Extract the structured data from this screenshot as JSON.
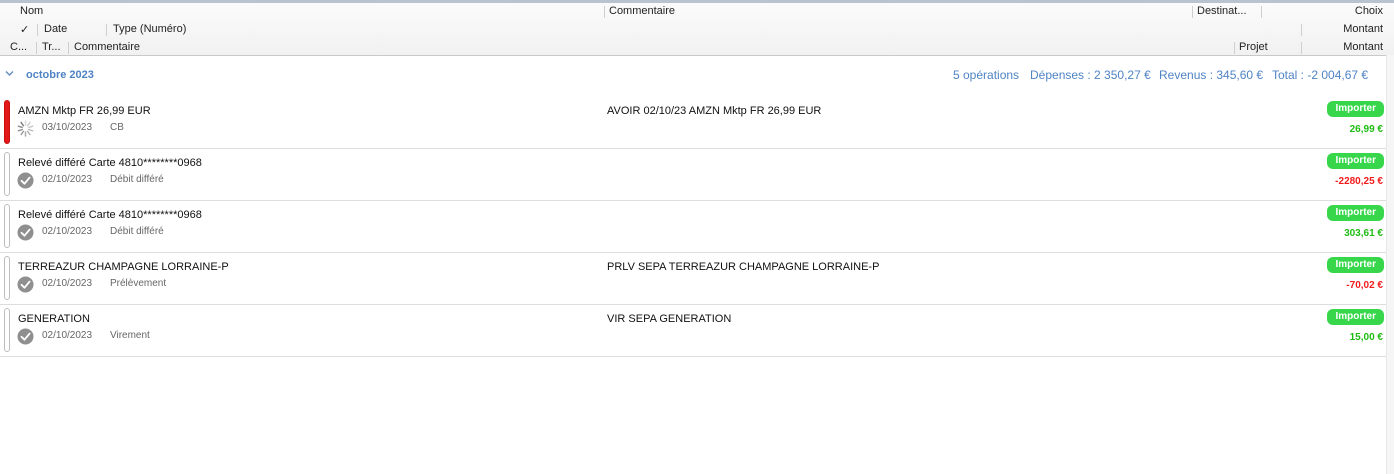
{
  "header": {
    "row1": {
      "name": "Nom",
      "comment": "Commentaire",
      "destination": "Destinat...",
      "choice": "Choix"
    },
    "row2": {
      "check": "✓",
      "date": "Date",
      "type": "Type (Numéro)",
      "amount": "Montant"
    },
    "row3": {
      "c": "C...",
      "tr": "Tr...",
      "comment": "Commentaire",
      "project": "Projet",
      "amount": "Montant"
    }
  },
  "group": {
    "title": "octobre 2023",
    "operations": "5 opérations",
    "expenses": "Dépenses : 2 350,27 €",
    "income": "Revenus : 345,60 €",
    "total": "Total : -2 004,67 €"
  },
  "colors": {
    "accent": "#4f83c4",
    "import": "#37d64b",
    "positive": "#1fbd14",
    "negative": "#f21b1b",
    "flag": "#e31818"
  },
  "rows": [
    {
      "name": "AMZN Mktp FR 26,99 EUR",
      "comment": "AVOIR 02/10/23 AMZN Mktp FR 26,99 EUR",
      "date": "03/10/2023",
      "type": "CB",
      "status": "spinner-icon",
      "marker": "red",
      "import_label": "Importer",
      "amount": "26,99 €",
      "sign": "pos"
    },
    {
      "name": "Relevé différé Carte 4810********0968",
      "comment": "",
      "date": "02/10/2023",
      "type": "Débit différé",
      "status": "check-circle-icon",
      "marker": "empty",
      "import_label": "Importer",
      "amount": "-2280,25 €",
      "sign": "neg"
    },
    {
      "name": "Relevé différé Carte 4810********0968",
      "comment": "",
      "date": "02/10/2023",
      "type": "Débit différé",
      "status": "check-circle-icon",
      "marker": "empty",
      "import_label": "Importer",
      "amount": "303,61 €",
      "sign": "pos"
    },
    {
      "name": "TERREAZUR CHAMPAGNE LORRAINE-P",
      "comment": "PRLV SEPA TERREAZUR CHAMPAGNE LORRAINE-P",
      "date": "02/10/2023",
      "type": "Prélèvement",
      "status": "check-circle-icon",
      "marker": "empty",
      "import_label": "Importer",
      "amount": "-70,02 €",
      "sign": "neg"
    },
    {
      "name": "GENERATION",
      "comment": "VIR SEPA GENERATION",
      "date": "02/10/2023",
      "type": "Virement",
      "status": "check-circle-icon",
      "marker": "empty",
      "import_label": "Importer",
      "amount": "15,00 €",
      "sign": "pos"
    }
  ]
}
